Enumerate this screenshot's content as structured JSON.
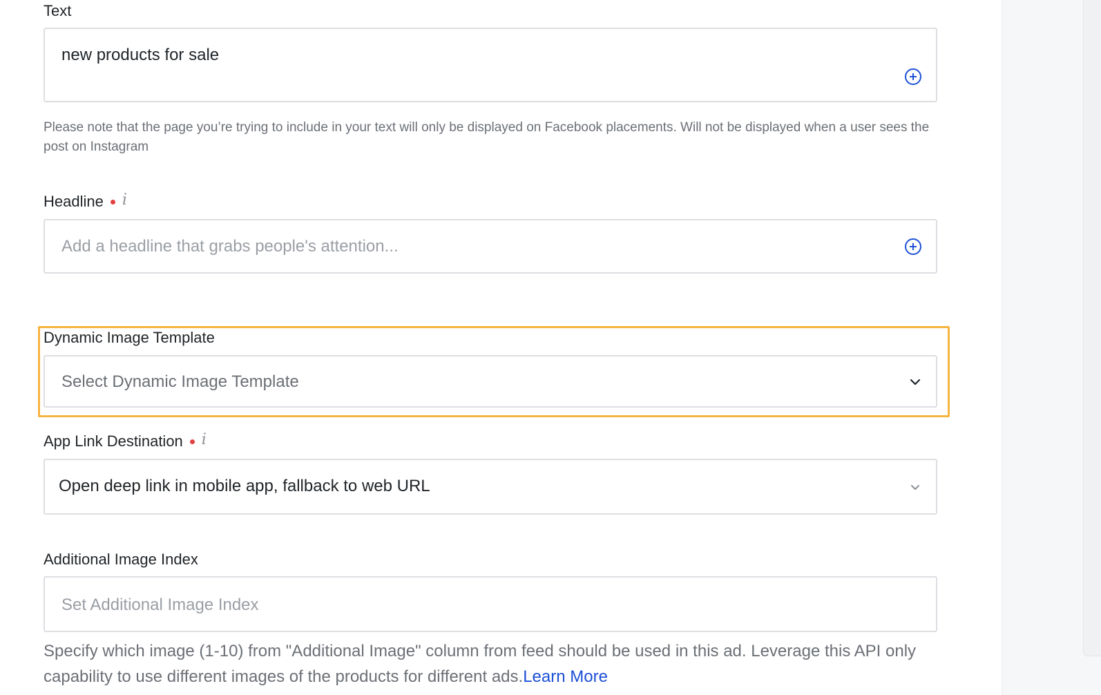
{
  "text_field": {
    "label": "Text",
    "value": "new products for sale",
    "note": "Please note that the page you’re trying to include in your text will only be displayed on Facebook placements. Will not be displayed when a user sees the post on Instagram"
  },
  "headline_field": {
    "label": "Headline",
    "info": "i",
    "placeholder": "Add a headline that grabs people's attention..."
  },
  "dynamic_image_template": {
    "label": "Dynamic Image Template",
    "placeholder": "Select Dynamic Image Template"
  },
  "app_link_destination": {
    "label": "App Link Destination",
    "info": "i",
    "value": "Open deep link in mobile app, fallback to web URL"
  },
  "additional_image_index": {
    "label": "Additional Image Index",
    "placeholder": "Set Additional Image Index",
    "help_text": "Specify which image (1-10) from \"Additional Image\" column from feed should be used in this ad. Leverage this API only capability to use different images of the products for different ads.",
    "learn_more": "Learn More"
  },
  "colors": {
    "accent_blue": "#1b4fd6",
    "required_red": "#e0413f",
    "highlight_orange": "#f5b440"
  },
  "icons": {
    "add": "plus-circle-icon",
    "dropdown": "chevron-down-icon",
    "info": "info-icon"
  }
}
